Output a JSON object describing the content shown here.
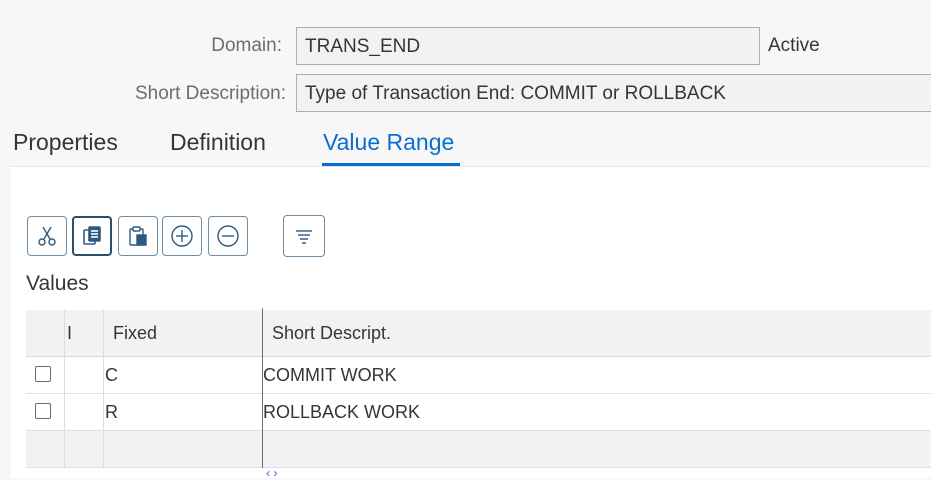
{
  "header": {
    "domain_label": "Domain:",
    "domain_value": "TRANS_END",
    "status": "Active",
    "short_desc_label": "Short Description:",
    "short_desc_value": "Type of Transaction End: COMMIT or ROLLBACK"
  },
  "tabs": [
    {
      "label": "Properties"
    },
    {
      "label": "Definition"
    },
    {
      "label": "Value Range",
      "active": true
    }
  ],
  "toolbar": {
    "buttons": [
      {
        "icon": "scissors-icon"
      },
      {
        "icon": "copy-icon",
        "selected": true
      },
      {
        "icon": "paste-icon"
      },
      {
        "icon": "plus-circle-icon"
      },
      {
        "icon": "minus-circle-icon"
      },
      {
        "icon": "filter-lines-icon"
      }
    ]
  },
  "values": {
    "title": "Values",
    "columns": [
      "I",
      "Fixed",
      "Short Descript."
    ],
    "rows": [
      {
        "fixed": "C",
        "short_descript": "COMMIT WORK"
      },
      {
        "fixed": "R",
        "short_descript": "ROLLBACK WORK"
      }
    ]
  },
  "scroll_hint": "‹ ›",
  "colors": {
    "accent": "#0a6ed1",
    "highlight": "#e9e13a"
  }
}
